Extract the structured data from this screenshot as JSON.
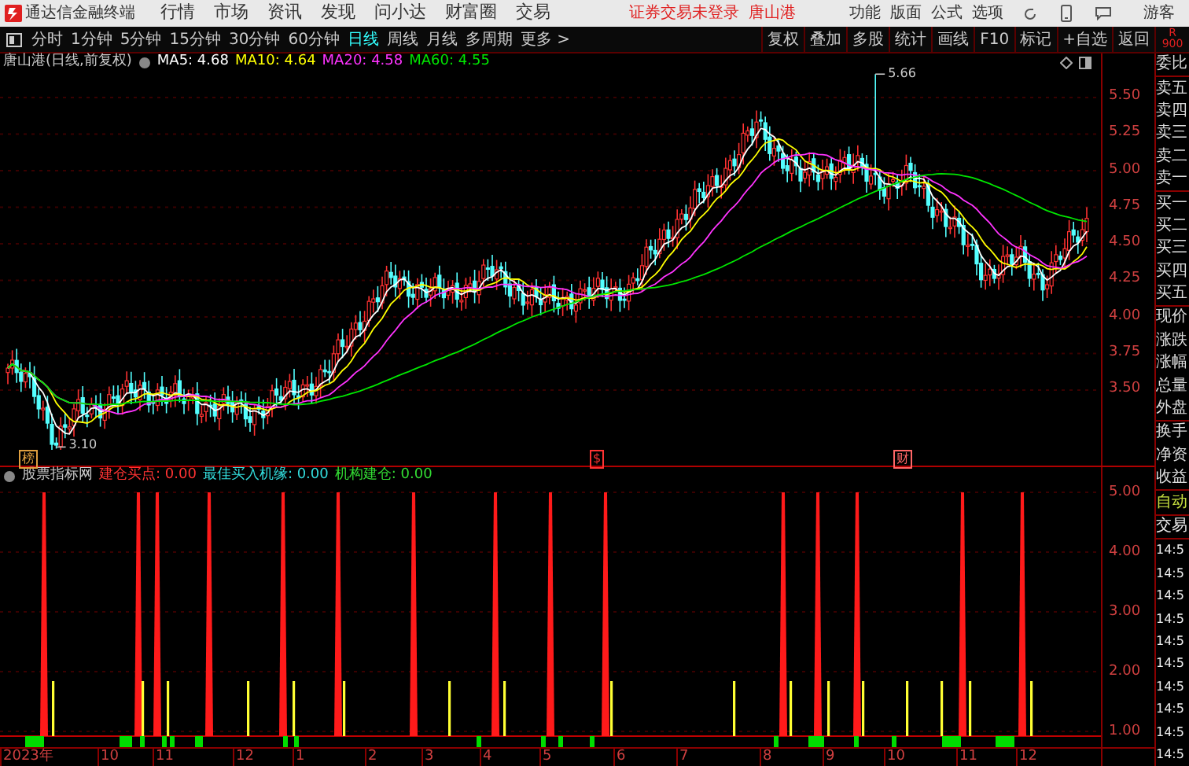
{
  "menubar": {
    "app_title": "通达信金融终端",
    "menus": [
      "行情",
      "市场",
      "资讯",
      "发现",
      "问小达",
      "财富圈",
      "交易"
    ],
    "login_status": "证券交易未登录",
    "stock": "唐山港",
    "right_menus": [
      "功能",
      "版面",
      "公式",
      "选项"
    ],
    "user": "游客"
  },
  "toolbar": {
    "periods": [
      {
        "label": "分时",
        "selected": false
      },
      {
        "label": "1分钟",
        "selected": false
      },
      {
        "label": "5分钟",
        "selected": false
      },
      {
        "label": "15分钟",
        "selected": false
      },
      {
        "label": "30分钟",
        "selected": false
      },
      {
        "label": "60分钟",
        "selected": false
      },
      {
        "label": "日线",
        "selected": true
      },
      {
        "label": "周线",
        "selected": false
      },
      {
        "label": "月线",
        "selected": false
      },
      {
        "label": "多周期",
        "selected": false
      }
    ],
    "more": "更多 >",
    "tools": [
      "复权",
      "叠加",
      "多股",
      "统计",
      "画线",
      "F10",
      "标记",
      "+自选",
      "返回"
    ],
    "badge": [
      "R",
      "900"
    ]
  },
  "price_chart": {
    "title": "唐山港(日线,前复权)",
    "ma": [
      {
        "label": "MA5: 4.68",
        "color": "#ffffff"
      },
      {
        "label": "MA10: 4.64",
        "color": "#ffff00"
      },
      {
        "label": "MA20: 4.58",
        "color": "#ff33ff"
      },
      {
        "label": "MA60: 4.55",
        "color": "#00e600"
      }
    ],
    "high_label": "5.66",
    "low_label": "3.10",
    "price_ticks": [
      "5.50",
      "5.25",
      "5.00",
      "4.75",
      "4.50",
      "4.25",
      "4.00",
      "3.75",
      "3.50"
    ],
    "markers": [
      {
        "text": "榜",
        "color": "#e0a040"
      },
      {
        "text": "$",
        "color": "#ff3333"
      },
      {
        "text": "财",
        "color": "#ff6666"
      }
    ]
  },
  "indicator": {
    "name": "股票指标网",
    "values": [
      {
        "label": "建仓买点: 0.00",
        "color": "#ff3333"
      },
      {
        "label": "最佳买入机缘: 0.00",
        "color": "#33dddd"
      },
      {
        "label": "机构建仓: 0.00",
        "color": "#33dd33"
      }
    ],
    "ticks": [
      "5.00",
      "4.00",
      "3.00",
      "2.00",
      "1.00"
    ]
  },
  "date_axis": [
    "2023年",
    "10",
    "11",
    "12",
    "1",
    "2",
    "3",
    "4",
    "5",
    "6",
    "7",
    "8",
    "9",
    "10",
    "11",
    "12"
  ],
  "quote_panel": [
    {
      "label": "委比",
      "kind": "header"
    },
    {
      "label": "卖五",
      "kind": "quote"
    },
    {
      "label": "卖四",
      "kind": "quote"
    },
    {
      "label": "卖三",
      "kind": "quote"
    },
    {
      "label": "卖二",
      "kind": "quote"
    },
    {
      "label": "卖一",
      "kind": "quote"
    },
    {
      "label": "买一",
      "kind": "bid"
    },
    {
      "label": "买二",
      "kind": "bid"
    },
    {
      "label": "买三",
      "kind": "bid"
    },
    {
      "label": "买四",
      "kind": "bid"
    },
    {
      "label": "买五",
      "kind": "bid"
    },
    {
      "label": "现价",
      "kind": "stat"
    },
    {
      "label": "涨跌",
      "kind": "stat"
    },
    {
      "label": "涨幅",
      "kind": "stat"
    },
    {
      "label": "总量",
      "kind": "stat"
    },
    {
      "label": "外盘",
      "kind": "stat"
    },
    {
      "label": "换手",
      "kind": "fin"
    },
    {
      "label": "净资",
      "kind": "fin"
    },
    {
      "label": "收益",
      "kind": "fin"
    },
    {
      "label": "自动",
      "kind": "auto"
    },
    {
      "label": "交易",
      "kind": "trade"
    },
    {
      "label": "14:5",
      "kind": "time"
    },
    {
      "label": "14:5",
      "kind": "time"
    },
    {
      "label": "14:5",
      "kind": "time"
    },
    {
      "label": "14:5",
      "kind": "time"
    },
    {
      "label": "14:5",
      "kind": "time"
    },
    {
      "label": "14:5",
      "kind": "time"
    },
    {
      "label": "14:5",
      "kind": "time"
    },
    {
      "label": "14:5",
      "kind": "time"
    },
    {
      "label": "14:5",
      "kind": "time"
    },
    {
      "label": "14:5",
      "kind": "time"
    }
  ]
}
